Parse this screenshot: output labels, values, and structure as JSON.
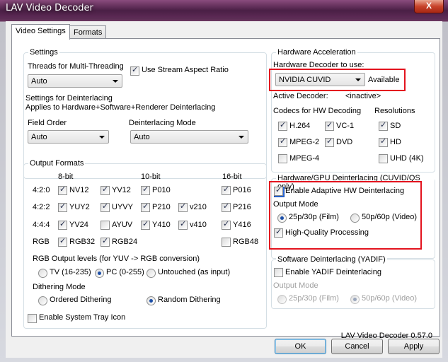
{
  "window": {
    "title": "LAV Video Decoder",
    "close_label": "X"
  },
  "tabs": [
    {
      "label": "Video Settings",
      "active": true
    },
    {
      "label": "Formats",
      "active": false
    }
  ],
  "settings": {
    "group_label": "Settings",
    "threads_label": "Threads for Multi-Threading",
    "threads_value": "Auto",
    "stream_aspect_label": "Use Stream Aspect Ratio",
    "deint_settings_label": "Settings for Deinterlacing",
    "deint_applies_label": "Applies to Hardware+Software+Renderer Deinterlacing",
    "field_order_label": "Field Order",
    "field_order_value": "Auto",
    "deint_mode_label": "Deinterlacing Mode",
    "deint_mode_value": "Auto"
  },
  "output_formats": {
    "group_label": "Output Formats",
    "col_8bit": "8-bit",
    "col_10bit": "10-bit",
    "col_16bit": "16-bit",
    "rows": [
      {
        "label": "4:2:0",
        "items": [
          {
            "name": "NV12",
            "checked": true
          },
          {
            "name": "YV12",
            "checked": true
          },
          {
            "name": "P010",
            "checked": true
          },
          {
            "name": "P016",
            "checked": true
          }
        ]
      },
      {
        "label": "4:2:2",
        "items": [
          {
            "name": "YUY2",
            "checked": true
          },
          {
            "name": "UYVY",
            "checked": true
          },
          {
            "name": "P210",
            "checked": true
          },
          {
            "name": "v210",
            "checked": true
          },
          {
            "name": "P216",
            "checked": true
          }
        ]
      },
      {
        "label": "4:4:4",
        "items": [
          {
            "name": "YV24",
            "checked": true
          },
          {
            "name": "AYUV",
            "checked": false
          },
          {
            "name": "Y410",
            "checked": true
          },
          {
            "name": "v410",
            "checked": true
          },
          {
            "name": "Y416",
            "checked": true
          }
        ]
      },
      {
        "label": "RGB",
        "items": [
          {
            "name": "RGB32",
            "checked": true
          },
          {
            "name": "RGB24",
            "checked": true
          },
          {
            "name": "RGB48",
            "checked": false
          }
        ]
      }
    ],
    "rgb_levels_label": "RGB Output levels (for YUV -> RGB conversion)",
    "rgb_levels_options": [
      "TV (16-235)",
      "PC (0-255)",
      "Untouched (as input)"
    ],
    "rgb_levels_selected": "PC (0-255)",
    "dithering_label": "Dithering Mode",
    "dithering_options": [
      "Ordered Dithering",
      "Random Dithering"
    ],
    "dithering_selected": "Random Dithering"
  },
  "system_tray": {
    "label": "Enable System Tray Icon",
    "checked": false
  },
  "hw_accel": {
    "group_label": "Hardware Acceleration",
    "decoder_label": "Hardware Decoder to use:",
    "decoder_value": "NVIDIA CUVID",
    "available_label": "Available",
    "active_decoder_label": "Active Decoder:",
    "active_decoder_value": "<inactive>",
    "codecs_label": "Codecs for HW Decoding",
    "resolutions_label": "Resolutions",
    "codecs": [
      {
        "name": "H.264",
        "checked": true
      },
      {
        "name": "VC-1",
        "checked": true
      },
      {
        "name": "MPEG-2",
        "checked": true
      },
      {
        "name": "DVD",
        "checked": true
      },
      {
        "name": "MPEG-4",
        "checked": false
      }
    ],
    "resolutions": [
      {
        "name": "SD",
        "checked": true
      },
      {
        "name": "HD",
        "checked": true
      },
      {
        "name": "UHD (4K)",
        "checked": false
      }
    ]
  },
  "hw_deint": {
    "group_label": "Hardware/GPU Deinterlacing (CUVID/QS only)",
    "enable_label": "Enable Adaptive HW Deinterlacing",
    "enable_checked": true,
    "output_mode_label": "Output Mode",
    "output_options": [
      "25p/30p (Film)",
      "50p/60p (Video)"
    ],
    "output_selected": "25p/30p (Film)",
    "hq_label": "High-Quality Processing",
    "hq_checked": true
  },
  "sw_deint": {
    "group_label": "Software Deinterlacing (YADIF)",
    "enable_label": "Enable YADIF Deinterlacing",
    "enable_checked": false,
    "output_mode_label": "Output Mode",
    "output_options": [
      "25p/30p (Film)",
      "50p/60p (Video)"
    ],
    "output_selected": "50p/60p (Video)"
  },
  "version_label": "LAV Video Decoder 0.57.0",
  "buttons": {
    "ok": "OK",
    "cancel": "Cancel",
    "apply": "Apply"
  },
  "colors": {
    "highlight_border": "#e3131e",
    "title_bar": "#4a1f45"
  }
}
